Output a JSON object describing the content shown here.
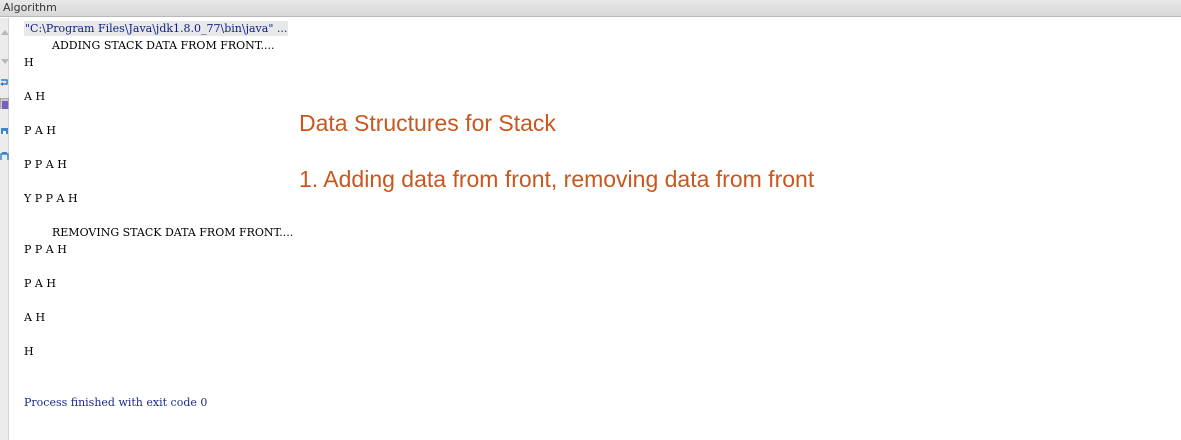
{
  "window": {
    "title": "Algorithm"
  },
  "gutter": {
    "icons": [
      "up-arrow-icon",
      "down-arrow-icon",
      "soft-wrap-icon",
      "scroll-to-end-icon",
      "print-icon",
      "trash-icon"
    ]
  },
  "console": {
    "command": "\"C:\\Program Files\\Java\\jdk1.8.0_77\\bin\\java\" ...",
    "adding_header": "ADDING STACK DATA FROM FRONT....",
    "adding_lines": [
      "H",
      "",
      "A H",
      "",
      "P A H",
      "",
      "P P A H",
      "",
      "Y P P A H",
      ""
    ],
    "removing_header": "REMOVING STACK DATA FROM FRONT....",
    "removing_lines": [
      "P P A H",
      "",
      "P A H",
      "",
      "A H",
      "",
      "H",
      "",
      ""
    ],
    "exit_message": "Process finished with exit code 0"
  },
  "overlay": {
    "title": "Data Structures for Stack",
    "subtitle": "1. Adding data from front, removing data from front"
  },
  "colors": {
    "overlay_text": "#c9571d",
    "command_text": "#0b1f88",
    "exit_text": "#1a2a8c"
  }
}
